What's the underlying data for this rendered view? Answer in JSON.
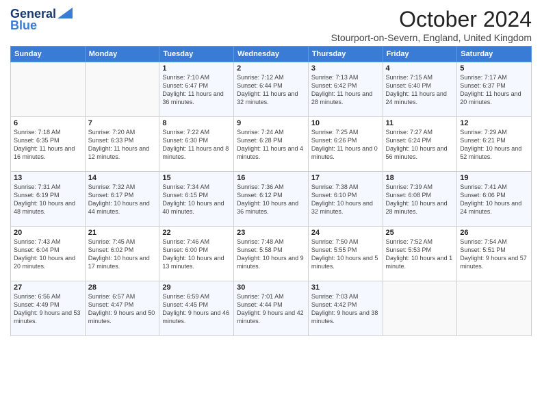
{
  "logo": {
    "general": "General",
    "blue": "Blue"
  },
  "title": "October 2024",
  "location": "Stourport-on-Severn, England, United Kingdom",
  "days_of_week": [
    "Sunday",
    "Monday",
    "Tuesday",
    "Wednesday",
    "Thursday",
    "Friday",
    "Saturday"
  ],
  "weeks": [
    [
      {
        "day": "",
        "info": ""
      },
      {
        "day": "",
        "info": ""
      },
      {
        "day": "1",
        "info": "Sunrise: 7:10 AM\nSunset: 6:47 PM\nDaylight: 11 hours and 36 minutes."
      },
      {
        "day": "2",
        "info": "Sunrise: 7:12 AM\nSunset: 6:44 PM\nDaylight: 11 hours and 32 minutes."
      },
      {
        "day": "3",
        "info": "Sunrise: 7:13 AM\nSunset: 6:42 PM\nDaylight: 11 hours and 28 minutes."
      },
      {
        "day": "4",
        "info": "Sunrise: 7:15 AM\nSunset: 6:40 PM\nDaylight: 11 hours and 24 minutes."
      },
      {
        "day": "5",
        "info": "Sunrise: 7:17 AM\nSunset: 6:37 PM\nDaylight: 11 hours and 20 minutes."
      }
    ],
    [
      {
        "day": "6",
        "info": "Sunrise: 7:18 AM\nSunset: 6:35 PM\nDaylight: 11 hours and 16 minutes."
      },
      {
        "day": "7",
        "info": "Sunrise: 7:20 AM\nSunset: 6:33 PM\nDaylight: 11 hours and 12 minutes."
      },
      {
        "day": "8",
        "info": "Sunrise: 7:22 AM\nSunset: 6:30 PM\nDaylight: 11 hours and 8 minutes."
      },
      {
        "day": "9",
        "info": "Sunrise: 7:24 AM\nSunset: 6:28 PM\nDaylight: 11 hours and 4 minutes."
      },
      {
        "day": "10",
        "info": "Sunrise: 7:25 AM\nSunset: 6:26 PM\nDaylight: 11 hours and 0 minutes."
      },
      {
        "day": "11",
        "info": "Sunrise: 7:27 AM\nSunset: 6:24 PM\nDaylight: 10 hours and 56 minutes."
      },
      {
        "day": "12",
        "info": "Sunrise: 7:29 AM\nSunset: 6:21 PM\nDaylight: 10 hours and 52 minutes."
      }
    ],
    [
      {
        "day": "13",
        "info": "Sunrise: 7:31 AM\nSunset: 6:19 PM\nDaylight: 10 hours and 48 minutes."
      },
      {
        "day": "14",
        "info": "Sunrise: 7:32 AM\nSunset: 6:17 PM\nDaylight: 10 hours and 44 minutes."
      },
      {
        "day": "15",
        "info": "Sunrise: 7:34 AM\nSunset: 6:15 PM\nDaylight: 10 hours and 40 minutes."
      },
      {
        "day": "16",
        "info": "Sunrise: 7:36 AM\nSunset: 6:12 PM\nDaylight: 10 hours and 36 minutes."
      },
      {
        "day": "17",
        "info": "Sunrise: 7:38 AM\nSunset: 6:10 PM\nDaylight: 10 hours and 32 minutes."
      },
      {
        "day": "18",
        "info": "Sunrise: 7:39 AM\nSunset: 6:08 PM\nDaylight: 10 hours and 28 minutes."
      },
      {
        "day": "19",
        "info": "Sunrise: 7:41 AM\nSunset: 6:06 PM\nDaylight: 10 hours and 24 minutes."
      }
    ],
    [
      {
        "day": "20",
        "info": "Sunrise: 7:43 AM\nSunset: 6:04 PM\nDaylight: 10 hours and 20 minutes."
      },
      {
        "day": "21",
        "info": "Sunrise: 7:45 AM\nSunset: 6:02 PM\nDaylight: 10 hours and 17 minutes."
      },
      {
        "day": "22",
        "info": "Sunrise: 7:46 AM\nSunset: 6:00 PM\nDaylight: 10 hours and 13 minutes."
      },
      {
        "day": "23",
        "info": "Sunrise: 7:48 AM\nSunset: 5:58 PM\nDaylight: 10 hours and 9 minutes."
      },
      {
        "day": "24",
        "info": "Sunrise: 7:50 AM\nSunset: 5:55 PM\nDaylight: 10 hours and 5 minutes."
      },
      {
        "day": "25",
        "info": "Sunrise: 7:52 AM\nSunset: 5:53 PM\nDaylight: 10 hours and 1 minute."
      },
      {
        "day": "26",
        "info": "Sunrise: 7:54 AM\nSunset: 5:51 PM\nDaylight: 9 hours and 57 minutes."
      }
    ],
    [
      {
        "day": "27",
        "info": "Sunrise: 6:56 AM\nSunset: 4:49 PM\nDaylight: 9 hours and 53 minutes."
      },
      {
        "day": "28",
        "info": "Sunrise: 6:57 AM\nSunset: 4:47 PM\nDaylight: 9 hours and 50 minutes."
      },
      {
        "day": "29",
        "info": "Sunrise: 6:59 AM\nSunset: 4:45 PM\nDaylight: 9 hours and 46 minutes."
      },
      {
        "day": "30",
        "info": "Sunrise: 7:01 AM\nSunset: 4:44 PM\nDaylight: 9 hours and 42 minutes."
      },
      {
        "day": "31",
        "info": "Sunrise: 7:03 AM\nSunset: 4:42 PM\nDaylight: 9 hours and 38 minutes."
      },
      {
        "day": "",
        "info": ""
      },
      {
        "day": "",
        "info": ""
      }
    ]
  ]
}
